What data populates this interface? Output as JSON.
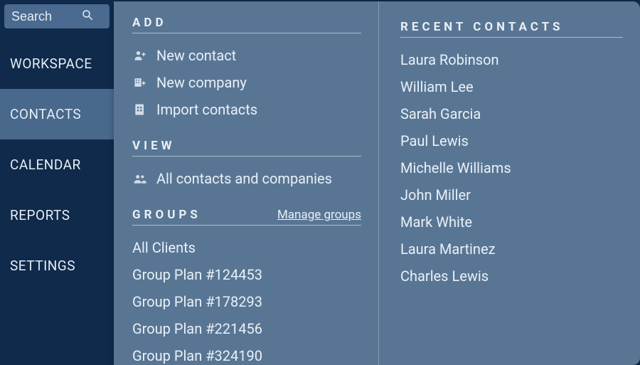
{
  "search": {
    "placeholder": "Search"
  },
  "nav": {
    "items": [
      {
        "id": "workspace",
        "label": "WORKSPACE"
      },
      {
        "id": "contacts",
        "label": "CONTACTS"
      },
      {
        "id": "calendar",
        "label": "CALENDAR"
      },
      {
        "id": "reports",
        "label": "REPORTS"
      },
      {
        "id": "settings",
        "label": "SETTINGS"
      }
    ],
    "active_index": 1
  },
  "flyout": {
    "add": {
      "title": "ADD",
      "items": [
        {
          "icon": "person-add-icon",
          "label": "New contact"
        },
        {
          "icon": "company-add-icon",
          "label": "New company"
        },
        {
          "icon": "import-icon",
          "label": "Import contacts"
        }
      ]
    },
    "view": {
      "title": "VIEW",
      "items": [
        {
          "icon": "people-icon",
          "label": "All contacts and companies"
        }
      ]
    },
    "groups": {
      "title": "GROUPS",
      "manage_label": "Manage groups",
      "items": [
        "All Clients",
        "Group Plan #124453",
        "Group Plan #178293",
        "Group Plan #221456",
        "Group Plan #324190"
      ]
    },
    "recent": {
      "title": "RECENT CONTACTS",
      "items": [
        "Laura Robinson",
        "William Lee",
        "Sarah Garcia",
        "Paul Lewis",
        "Michelle Williams",
        "John Miller",
        "Mark White",
        "Laura Martinez",
        "Charles Lewis"
      ]
    }
  }
}
